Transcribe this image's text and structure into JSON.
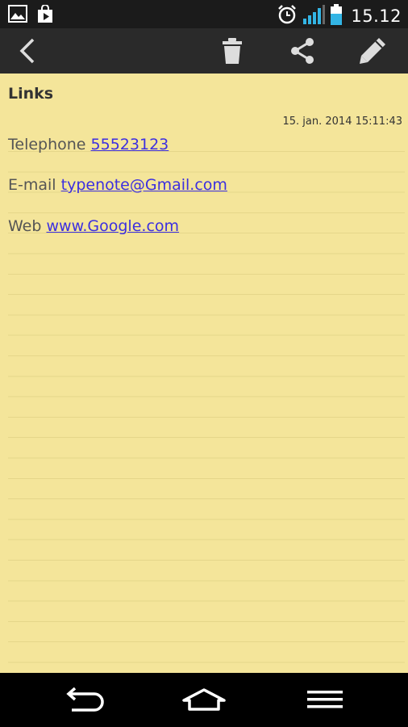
{
  "status_bar": {
    "time": "15.12",
    "icons": [
      "gallery-icon",
      "play-store-icon",
      "alarm-icon",
      "signal-icon",
      "battery-icon"
    ]
  },
  "action_bar": {
    "icons": [
      "back-icon",
      "trash-icon",
      "share-icon",
      "edit-icon"
    ]
  },
  "note": {
    "title": "Links",
    "timestamp": "15. jan. 2014 15:11:43",
    "lines": [
      {
        "label": "Telephone",
        "link": "55523123"
      },
      {
        "label": "E-mail",
        "link": "typenote@Gmail.com"
      },
      {
        "label": "Web",
        "link": "www.Google.com"
      }
    ],
    "paper_color": "#f4e59a",
    "link_color": "#3c2fe0"
  },
  "nav_bar": {
    "icons": [
      "nav-back-icon",
      "nav-home-icon",
      "nav-menu-icon"
    ]
  }
}
